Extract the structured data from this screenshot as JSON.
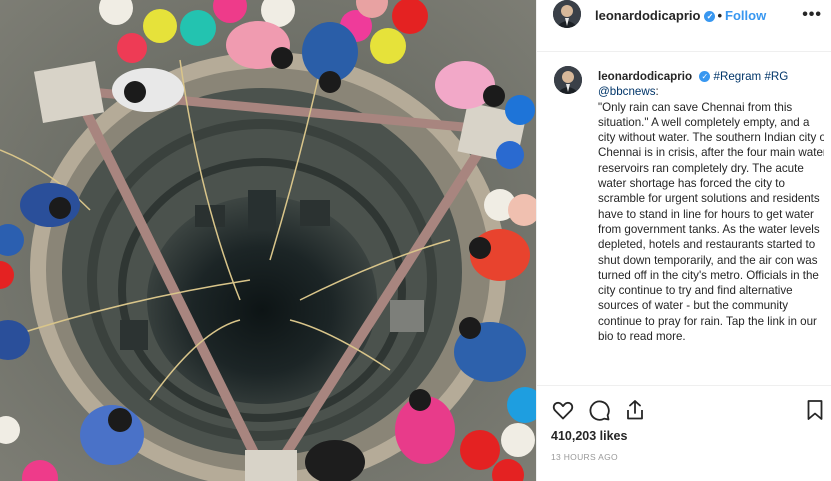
{
  "post": {
    "image_alt": "",
    "username": "leonardodicaprio",
    "verified_symbol": "✓",
    "dot": "•",
    "follow_label": "Follow",
    "more_symbol": "•••"
  },
  "caption": {
    "username": "leonardodicaprio",
    "tag1": "#Regram",
    "tag2": "#RG",
    "mention": "@bbcnews",
    "colon": ":",
    "text": "\"Only rain can save Chennai from this situation.\" A well completely empty, and a city without water. The southern Indian city of Chennai is in crisis, after the four main water reservoirs ran completely dry. The acute water shortage has forced the city to scramble for urgent solutions and residents have to stand in line for hours to get water from government tanks. As the water levels depleted, hotels and restaurants started to shut down temporarily, and the air con was turned off in the city's metro. Officials in the city continue to try and find alternative sources of water - but the community continue to pray for rain. Tap the link in our bio to read more."
  },
  "stats": {
    "likes": "410,203 likes",
    "time_ago": "13 HOURS AGO"
  },
  "icons": {
    "like": "heart-icon",
    "comment": "comment-icon",
    "share": "share-icon",
    "save": "bookmark-icon",
    "verified": "verified-badge-icon",
    "more": "more-options-icon"
  },
  "colors": {
    "accent": "#3897f0",
    "hashtag": "#003569",
    "text": "#262626",
    "muted": "#999999"
  }
}
